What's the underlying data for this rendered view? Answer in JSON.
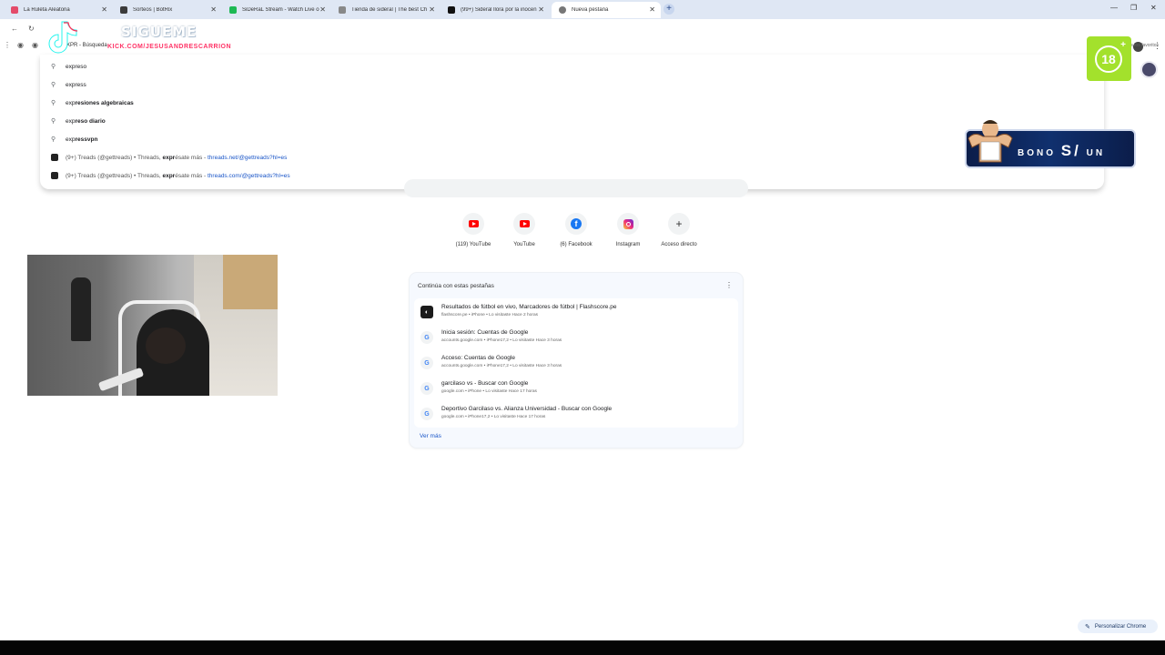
{
  "tabs": [
    {
      "title": "La Ruleta Aleatoria",
      "fav_color": "#e44b6a"
    },
    {
      "title": "Sorteos | BotRix",
      "fav_color": "#3b3b3b"
    },
    {
      "title": "SiDeRaL Stream - Watch Live o",
      "fav_color": "#1db954"
    },
    {
      "title": "Tienda de sideral | The best Ch",
      "fav_color": "#888888"
    },
    {
      "title": "(99+) Sideral llora por la inocen",
      "fav_color": "#111111"
    },
    {
      "title": "Nueva pestaña",
      "fav_color": "#777777"
    }
  ],
  "omnibox": {
    "text": "XPR - Búsqueda"
  },
  "bookmarks": {
    "label": "Todos los favoritos"
  },
  "suggestions": [
    {
      "prefix": "exp",
      "rest": "reso",
      "bold_rest": false
    },
    {
      "prefix": "exp",
      "rest": "ress",
      "bold_rest": false
    },
    {
      "prefix": "exp",
      "rest": "resiones algebraicas",
      "bold_rest": true
    },
    {
      "prefix": "exp",
      "rest": "reso diario",
      "bold_rest": true
    },
    {
      "prefix": "exp",
      "rest": "ressvpn",
      "bold_rest": true
    }
  ],
  "site_suggestions": [
    {
      "pre": "(9+) Treads (@gettreads) • Threads, ",
      "bold": "expr",
      "post": "ésate más",
      "sep": " - ",
      "url": "threads.net/@gettreads?hl=es"
    },
    {
      "pre": "(9+) Treads (@gettreads) • Threads, ",
      "bold": "expr",
      "post": "ésate más",
      "sep": " - ",
      "url": "threads.com/@gettreads?hl=es"
    }
  ],
  "overlays": {
    "sigueme": "SIGUEME",
    "handle": "KICK.COM/JESUSANDRESCARRION",
    "age_badge": "18",
    "age_plus": "+",
    "bono_a": "BONO",
    "bono_b": "S/",
    "bono_c": "UN"
  },
  "shortcuts": [
    {
      "label": "(119) YouTube",
      "icon": "youtube-icon"
    },
    {
      "label": "YouTube",
      "icon": "youtube-icon"
    },
    {
      "label": "(6) Facebook",
      "icon": "facebook-icon"
    },
    {
      "label": "Instagram",
      "icon": "instagram-icon"
    },
    {
      "label": "Acceso directo",
      "icon": "plus-icon"
    }
  ],
  "continue_card": {
    "title": "Continúa con estas pestañas",
    "rows": [
      {
        "title": "Resultados de fútbol en vivo, Marcadores de fútbol | Flashscore.pe",
        "meta": "flashscore.pe • iPhone • Lo visitaste Hace 2 horas",
        "icon": "flashscore-icon"
      },
      {
        "title": "Inicia sesión: Cuentas de Google",
        "meta": "accounts.google.com • iPhone17,2 • Lo visitaste Hace 3 horas",
        "icon": "google-icon"
      },
      {
        "title": "Acceso: Cuentas de Google",
        "meta": "accounts.google.com • iPhone17,2 • Lo visitaste Hace 3 horas",
        "icon": "google-icon"
      },
      {
        "title": "garcilaso vs - Buscar con Google",
        "meta": "google.com • iPhone • Lo visitaste Hace 17 horas",
        "icon": "google-icon"
      },
      {
        "title": "Deportivo Garcilaso vs. Alianza Universidad - Buscar con Google",
        "meta": "google.com • iPhone17,2 • Lo visitaste Hace 17 horas",
        "icon": "google-icon"
      }
    ],
    "more": "Ver más"
  },
  "personalize": "Personalizar Chrome",
  "colors": {
    "tabstrip": "#dfe7f4",
    "accent": "#1a56c8",
    "badge": "#a3e12c"
  }
}
